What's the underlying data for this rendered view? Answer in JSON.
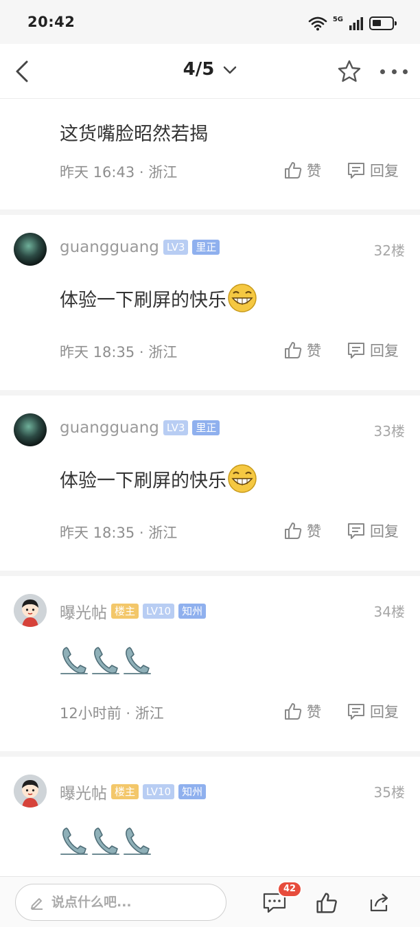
{
  "status_bar": {
    "time": "20:42",
    "network": "5G"
  },
  "nav": {
    "pager": "4/5"
  },
  "posts": [
    {
      "text": "这货嘴脸昭然若揭",
      "time_location": "昨天 16:43 · 浙江",
      "like_label": "赞",
      "reply_label": "回复"
    },
    {
      "username": "guangguang",
      "level": "LV3",
      "region_badge": "里正",
      "floor": "32楼",
      "text": "体验一下刷屏的快乐",
      "emoji": "grin-emoji",
      "time_location": "昨天 18:35 · 浙江",
      "like_label": "赞",
      "reply_label": "回复"
    },
    {
      "username": "guangguang",
      "level": "LV3",
      "region_badge": "里正",
      "floor": "33楼",
      "text": "体验一下刷屏的快乐",
      "emoji": "grin-emoji",
      "time_location": "昨天 18:35 · 浙江",
      "like_label": "赞",
      "reply_label": "回复"
    },
    {
      "username": "曝光帖",
      "owner_badge": "楼主",
      "level": "LV10",
      "region_badge": "知州",
      "floor": "34楼",
      "stickers": [
        "phone-sticker",
        "phone-sticker",
        "phone-sticker"
      ],
      "time_location": "12小时前 · 浙江",
      "like_label": "赞",
      "reply_label": "回复"
    },
    {
      "username": "曝光帖",
      "owner_badge": "楼主",
      "level": "LV10",
      "region_badge": "知州",
      "floor": "35楼",
      "stickers": [
        "phone-sticker",
        "phone-sticker",
        "phone-sticker"
      ]
    }
  ],
  "bottom_bar": {
    "input_placeholder": "说点什么吧...",
    "comment_count": "42"
  },
  "colors": {
    "owner_badge": "#f3c76a",
    "level_badge": "#b8cdf3",
    "region_badge": "#8fb0ee",
    "count_badge": "#e74c3c"
  }
}
